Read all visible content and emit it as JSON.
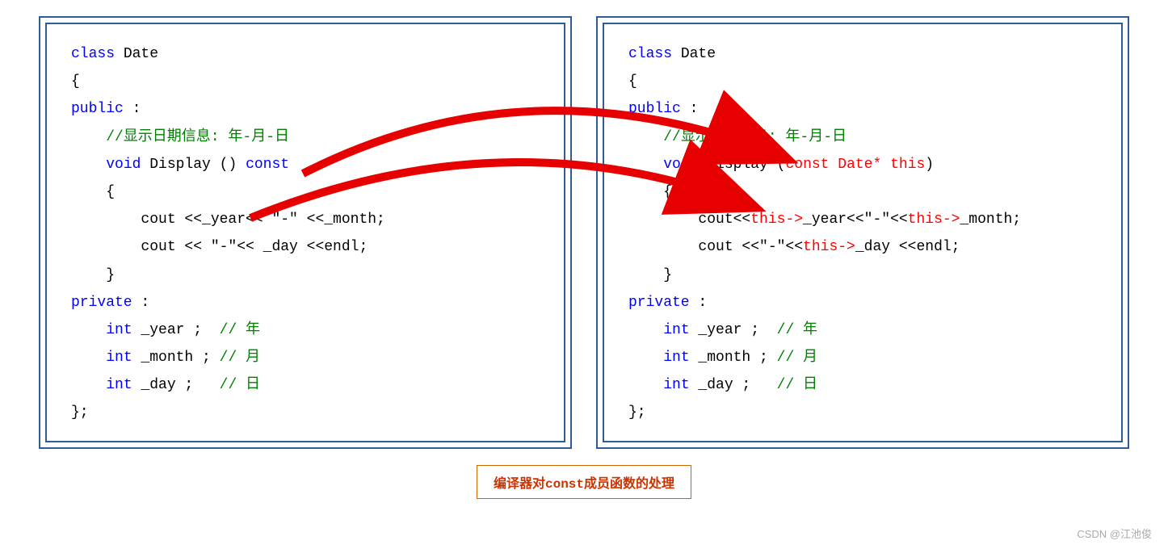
{
  "left": {
    "l1a": "class",
    "l1b": " Date",
    "l2": "{",
    "l3a": "public",
    "l3b": " :",
    "l4": "    //显示日期信息: 年-月-日",
    "l5a": "    ",
    "l5b": "void",
    "l5c": " Display () ",
    "l5d": "const",
    "l6": "    {",
    "l7": "        cout <<_year<< \"-\" <<_month;",
    "l8": "        cout << \"-\"<< _day <<endl;",
    "l9": "    }",
    "l10a": "private",
    "l10b": " :",
    "l11a": "    ",
    "l11b": "int",
    "l11c": " _year ;  ",
    "l11d": "// 年",
    "l12a": "    ",
    "l12b": "int",
    "l12c": " _month ; ",
    "l12d": "// 月",
    "l13a": "    ",
    "l13b": "int",
    "l13c": " _day ;   ",
    "l13d": "// 日",
    "l14": "};"
  },
  "right": {
    "l1a": "class",
    "l1b": " Date",
    "l2": "{",
    "l3a": "public",
    "l3b": " :",
    "l4a": "    ",
    "l4b": "//",
    "l4c": "显示日期信息: 年-月-日",
    "l5a": "    ",
    "l5b": "void",
    "l5c": " Display (",
    "l5d": "const Date* this",
    "l5e": ")",
    "l6": "    {",
    "l7a": "        cout<<",
    "l7b": "this->",
    "l7c": "_year<<\"-\"<<",
    "l7d": "this->",
    "l7e": "_month;",
    "l8a": "        cout <<\"-\"<<",
    "l8b": "this->",
    "l8c": "_day <<endl;",
    "l9": "    }",
    "l10a": "private",
    "l10b": " :",
    "l11a": "    ",
    "l11b": "int",
    "l11c": " _year ;  ",
    "l11d": "// 年",
    "l12a": "    ",
    "l12b": "int",
    "l12c": " _month ; ",
    "l12d": "// 月",
    "l13a": "    ",
    "l13b": "int",
    "l13c": " _day ;   ",
    "l13d": "// 日",
    "l14": "};"
  },
  "caption": "编译器对const成员函数的处理",
  "watermark": "CSDN @江池俊"
}
